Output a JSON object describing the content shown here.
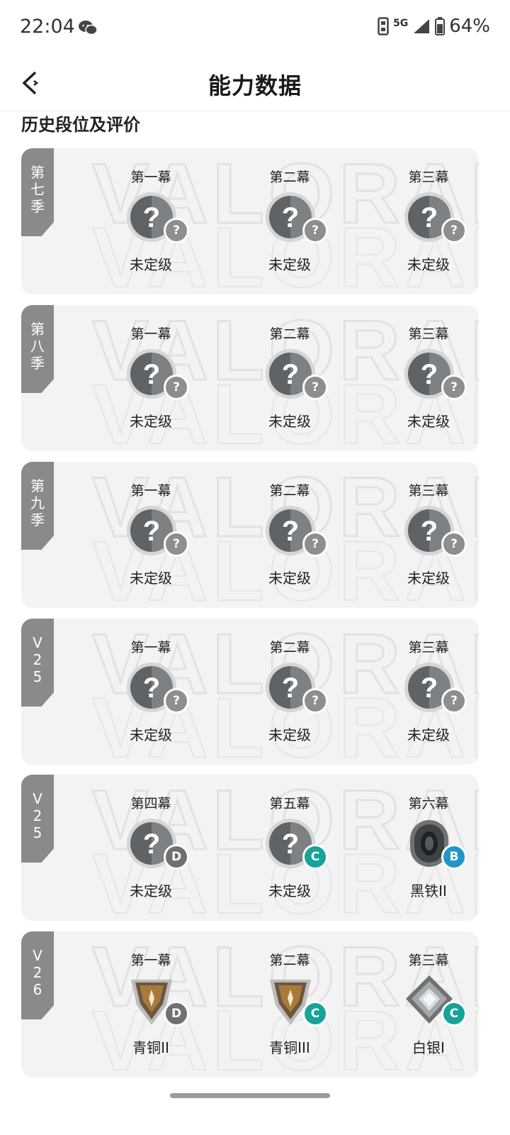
{
  "status_bar": {
    "time": "22:04",
    "network": "5G",
    "battery": "64%",
    "icons": [
      "wechat-icon",
      "nfc-icon",
      "signal-icon",
      "battery-icon"
    ]
  },
  "header": {
    "title": "能力数据",
    "back_icon": "back-arrow-icon"
  },
  "section_title": "历史段位及评价",
  "colors": {
    "card_bg": "#f3f3f3",
    "season_tab": "#8a8a8a",
    "badge_grey": "#8e8e8e",
    "badge_teal": "#17a39a",
    "badge_blue": "#1e97c8",
    "bronze": "#9a6a2a",
    "silver": "#9aa0a4"
  },
  "seasons": [
    {
      "label": "第七季",
      "acts": [
        {
          "name": "第一幕",
          "rank": "未定级",
          "icon": "unranked-icon",
          "grade": "?",
          "grade_color": "#8e8e8e"
        },
        {
          "name": "第二幕",
          "rank": "未定级",
          "icon": "unranked-icon",
          "grade": "?",
          "grade_color": "#8e8e8e"
        },
        {
          "name": "第三幕",
          "rank": "未定级",
          "icon": "unranked-icon",
          "grade": "?",
          "grade_color": "#8e8e8e"
        }
      ]
    },
    {
      "label": "第八季",
      "acts": [
        {
          "name": "第一幕",
          "rank": "未定级",
          "icon": "unranked-icon",
          "grade": "?",
          "grade_color": "#8e8e8e"
        },
        {
          "name": "第二幕",
          "rank": "未定级",
          "icon": "unranked-icon",
          "grade": "?",
          "grade_color": "#8e8e8e"
        },
        {
          "name": "第三幕",
          "rank": "未定级",
          "icon": "unranked-icon",
          "grade": "?",
          "grade_color": "#8e8e8e"
        }
      ]
    },
    {
      "label": "第九季",
      "acts": [
        {
          "name": "第一幕",
          "rank": "未定级",
          "icon": "unranked-icon",
          "grade": "?",
          "grade_color": "#8e8e8e"
        },
        {
          "name": "第二幕",
          "rank": "未定级",
          "icon": "unranked-icon",
          "grade": "?",
          "grade_color": "#8e8e8e"
        },
        {
          "name": "第三幕",
          "rank": "未定级",
          "icon": "unranked-icon",
          "grade": "?",
          "grade_color": "#8e8e8e"
        }
      ]
    },
    {
      "label": "V25",
      "acts": [
        {
          "name": "第一幕",
          "rank": "未定级",
          "icon": "unranked-icon",
          "grade": "?",
          "grade_color": "#8e8e8e"
        },
        {
          "name": "第二幕",
          "rank": "未定级",
          "icon": "unranked-icon",
          "grade": "?",
          "grade_color": "#8e8e8e"
        },
        {
          "name": "第三幕",
          "rank": "未定级",
          "icon": "unranked-icon",
          "grade": "?",
          "grade_color": "#8e8e8e"
        }
      ]
    },
    {
      "label": "V25",
      "acts": [
        {
          "name": "第四幕",
          "rank": "未定级",
          "icon": "unranked-icon",
          "grade": "D",
          "grade_color": "#707070"
        },
        {
          "name": "第五幕",
          "rank": "未定级",
          "icon": "unranked-icon",
          "grade": "C",
          "grade_color": "#17a39a"
        },
        {
          "name": "第六幕",
          "rank": "黑铁II",
          "icon": "iron-rank-icon",
          "grade": "B",
          "grade_color": "#1e97c8"
        }
      ]
    },
    {
      "label": "V26",
      "acts": [
        {
          "name": "第一幕",
          "rank": "青铜II",
          "icon": "bronze-rank-icon",
          "grade": "D",
          "grade_color": "#707070"
        },
        {
          "name": "第二幕",
          "rank": "青铜III",
          "icon": "bronze-rank-icon",
          "grade": "C",
          "grade_color": "#17a39a"
        },
        {
          "name": "第三幕",
          "rank": "白银I",
          "icon": "silver-rank-icon",
          "grade": "C",
          "grade_color": "#17a39a"
        }
      ]
    }
  ]
}
